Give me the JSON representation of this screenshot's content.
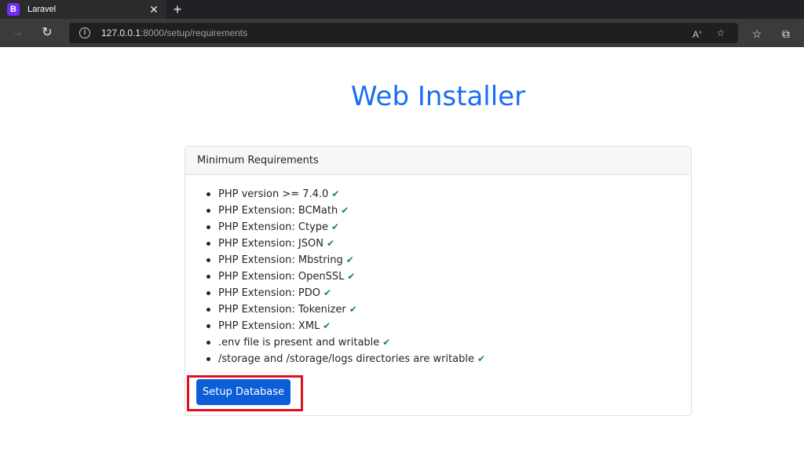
{
  "browser": {
    "tab_title": "Laravel",
    "favicon_letter": "B",
    "url_host": "127.0.0.1",
    "url_path": ":8000/setup/requirements"
  },
  "page": {
    "title": "Web Installer"
  },
  "card": {
    "header": "Minimum Requirements",
    "requirements": [
      "PHP version >= 7.4.0",
      "PHP Extension: BCMath",
      "PHP Extension: Ctype",
      "PHP Extension: JSON",
      "PHP Extension: Mbstring",
      "PHP Extension: OpenSSL",
      "PHP Extension: PDO",
      "PHP Extension: Tokenizer",
      "PHP Extension: XML",
      ".env file is present and writable",
      "/storage and /storage/logs directories are writable"
    ],
    "button_label": "Setup Database"
  },
  "colors": {
    "title": "#1a6ef0",
    "check": "#198754",
    "button": "#0b5ed7",
    "highlight": "#e0101e"
  }
}
